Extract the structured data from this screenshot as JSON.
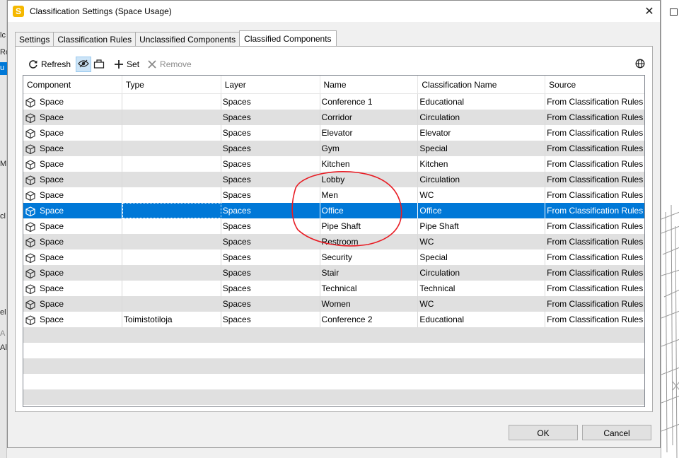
{
  "background": {
    "left_fragments": [
      "lc",
      "Ro",
      "u",
      "M",
      "cl",
      "el",
      "A",
      "Al"
    ]
  },
  "dialog": {
    "title": "Classification Settings (Space Usage)",
    "app_icon_letter": "S",
    "close_glyph": "✕"
  },
  "tabs": [
    {
      "label": "Settings",
      "active": false
    },
    {
      "label": "Classification Rules",
      "active": false
    },
    {
      "label": "Unclassified Components",
      "active": false
    },
    {
      "label": "Classified Components",
      "active": true
    }
  ],
  "toolbar": {
    "refresh_label": "Refresh",
    "set_label": "Set",
    "remove_label": "Remove",
    "icons": [
      "refresh-icon",
      "eye-icon",
      "folder-icon",
      "plus-icon",
      "x-icon",
      "globe-icon"
    ]
  },
  "grid": {
    "columns": [
      "Component",
      "Type",
      "Layer",
      "Name",
      "Classification Name",
      "Source"
    ],
    "rows": [
      {
        "component": "Space",
        "type": "",
        "layer": "Spaces",
        "name": "Conference 1",
        "classification": "Educational",
        "source": "From Classification Rules"
      },
      {
        "component": "Space",
        "type": "",
        "layer": "Spaces",
        "name": "Corridor",
        "classification": "Circulation",
        "source": "From Classification Rules"
      },
      {
        "component": "Space",
        "type": "",
        "layer": "Spaces",
        "name": "Elevator",
        "classification": "Elevator",
        "source": "From Classification Rules"
      },
      {
        "component": "Space",
        "type": "",
        "layer": "Spaces",
        "name": "Gym",
        "classification": "Special",
        "source": "From Classification Rules"
      },
      {
        "component": "Space",
        "type": "",
        "layer": "Spaces",
        "name": "Kitchen",
        "classification": "Kitchen",
        "source": "From Classification Rules"
      },
      {
        "component": "Space",
        "type": "",
        "layer": "Spaces",
        "name": "Lobby",
        "classification": "Circulation",
        "source": "From Classification Rules"
      },
      {
        "component": "Space",
        "type": "",
        "layer": "Spaces",
        "name": "Men",
        "classification": "WC",
        "source": "From Classification Rules"
      },
      {
        "component": "Space",
        "type": "",
        "layer": "Spaces",
        "name": "Office",
        "classification": "Office",
        "source": "From Classification Rules"
      },
      {
        "component": "Space",
        "type": "",
        "layer": "Spaces",
        "name": "Pipe Shaft",
        "classification": "Pipe Shaft",
        "source": "From Classification Rules"
      },
      {
        "component": "Space",
        "type": "",
        "layer": "Spaces",
        "name": "Restroom",
        "classification": "WC",
        "source": "From Classification Rules"
      },
      {
        "component": "Space",
        "type": "",
        "layer": "Spaces",
        "name": "Security",
        "classification": "Special",
        "source": "From Classification Rules"
      },
      {
        "component": "Space",
        "type": "",
        "layer": "Spaces",
        "name": "Stair",
        "classification": "Circulation",
        "source": "From Classification Rules"
      },
      {
        "component": "Space",
        "type": "",
        "layer": "Spaces",
        "name": "Technical",
        "classification": "Technical",
        "source": "From Classification Rules"
      },
      {
        "component": "Space",
        "type": "",
        "layer": "Spaces",
        "name": "Women",
        "classification": "WC",
        "source": "From Classification Rules"
      },
      {
        "component": "Space",
        "type": "Toimistotiloja",
        "layer": "Spaces",
        "name": "Conference 2",
        "classification": "Educational",
        "source": "From Classification Rules"
      }
    ],
    "selected_row_index": 7,
    "empty_row_count": 5
  },
  "buttons": {
    "ok_label": "OK",
    "cancel_label": "Cancel"
  },
  "colors": {
    "selection": "#0078d7",
    "stripe": "#e0e0e0",
    "annotation": "#e81c24",
    "app_icon": "#f5b800"
  }
}
